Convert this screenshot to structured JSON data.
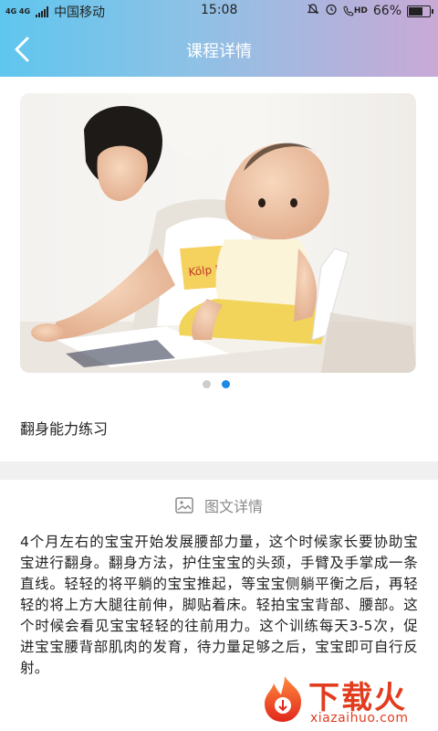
{
  "status_bar": {
    "network": "4G 4G",
    "carrier": "中国移动",
    "time": "15:08",
    "volte": "HD",
    "battery": "66%",
    "battery_level": 0.66
  },
  "header": {
    "title": "课程详情"
  },
  "carousel": {
    "image": "mother-and-baby-reading-photo",
    "page_count": 2,
    "active_index": 1
  },
  "course": {
    "title": "翻身能力练习"
  },
  "detail": {
    "heading": "图文详情",
    "body": "4个月左右的宝宝开始发展腰部力量，这个时候家长要协助宝宝进行翻身。翻身方法，护住宝宝的头颈，手臂及手掌成一条直线。轻轻的将平躺的宝宝推起，等宝宝侧躺平衡之后，再轻轻的将上方大腿往前伸，脚贴着床。轻拍宝宝背部、腰部。这个时候会看见宝宝轻轻的往前用力。这个训练每天3-5次，促进宝宝腰背部肌肉的发育，待力量足够之后，宝宝即可自行反射。"
  },
  "watermark": {
    "brand": "下载火",
    "domain": "xiazaihuo.com"
  },
  "colors": {
    "header_start": "#5fc6ee",
    "header_end": "#c9a9d6",
    "accent": "#1e88e5",
    "watermark": "#e23c1e"
  }
}
